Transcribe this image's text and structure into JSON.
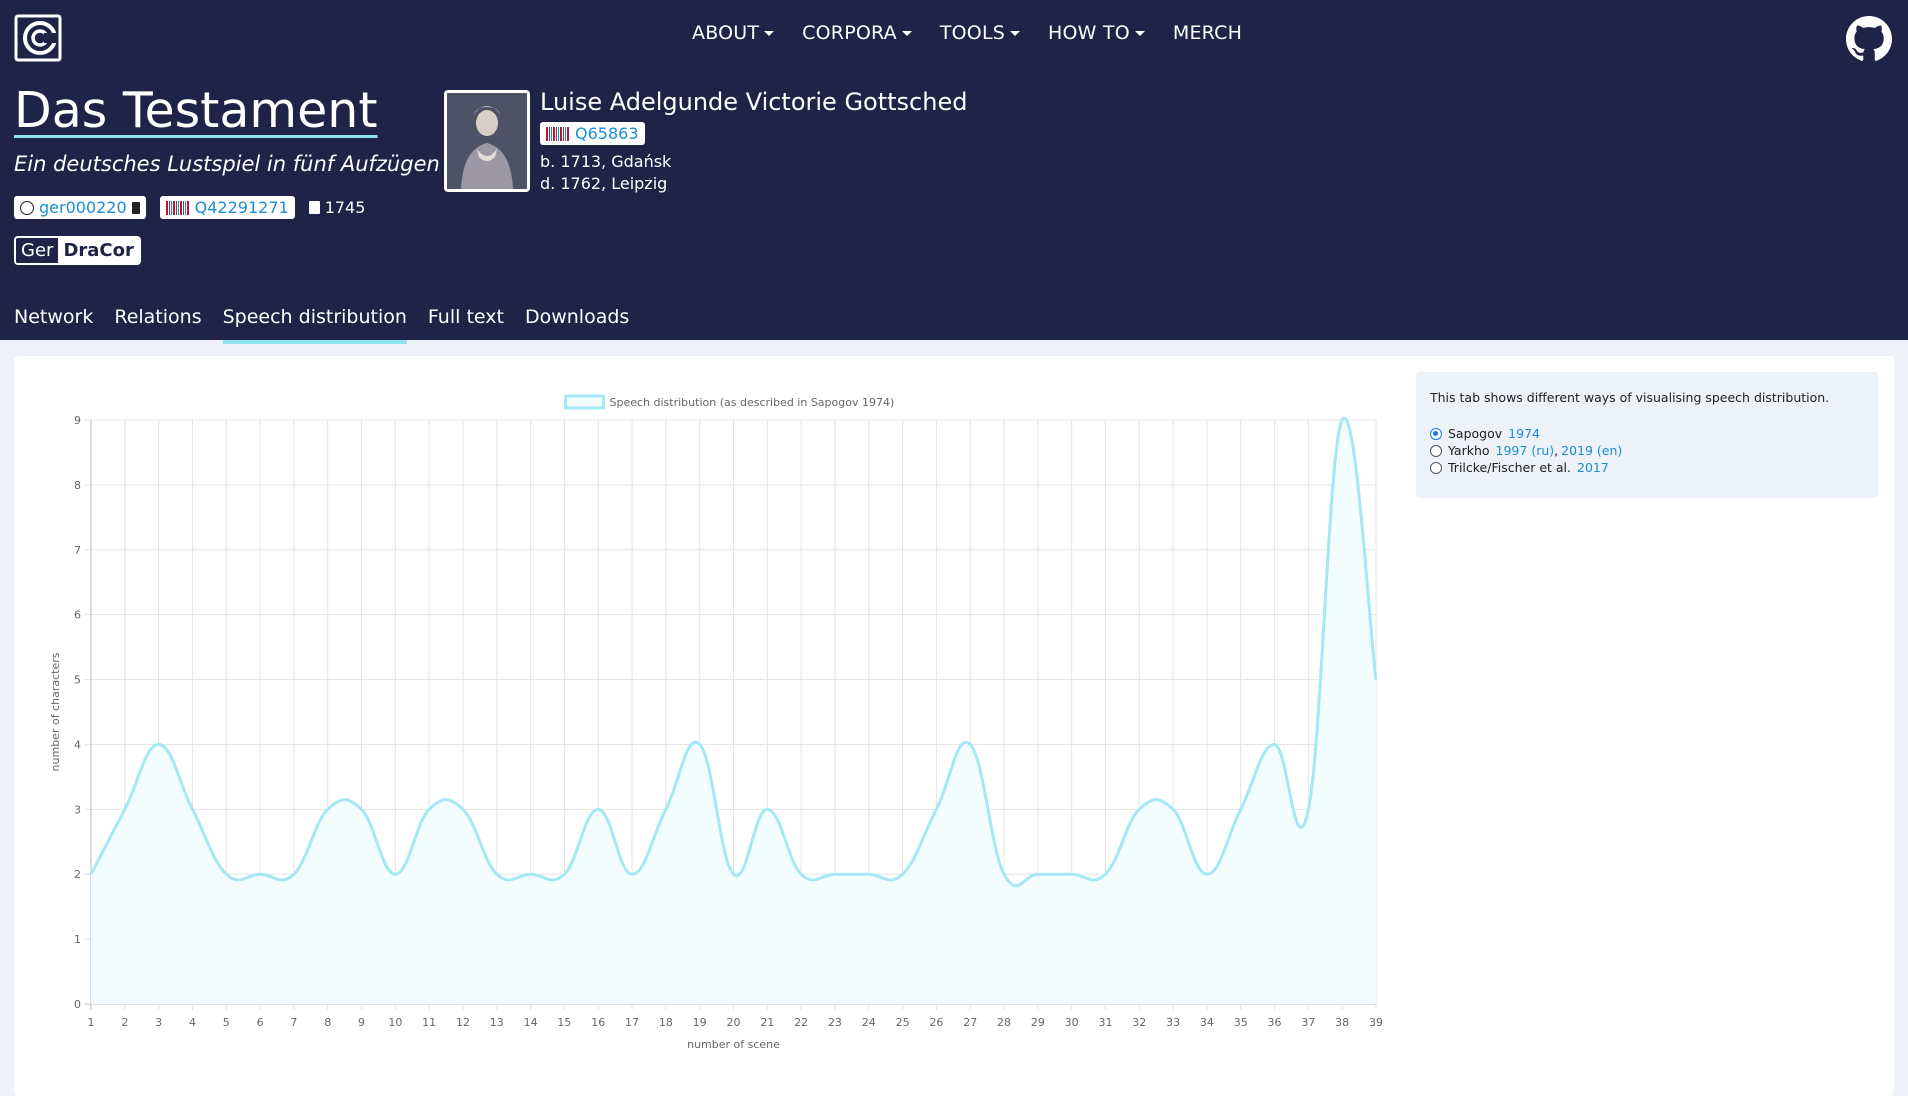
{
  "nav": {
    "items": [
      {
        "label": "ABOUT",
        "dropdown": true
      },
      {
        "label": "CORPORA",
        "dropdown": true
      },
      {
        "label": "TOOLS",
        "dropdown": true
      },
      {
        "label": "HOW TO",
        "dropdown": true
      },
      {
        "label": "MERCH",
        "dropdown": false
      }
    ]
  },
  "play": {
    "title": "Das Testament",
    "subtitle": "Ein deutsches Lustspiel in fünf Aufzügen",
    "dracor_id": "ger000220",
    "wikidata_id": "Q42291271",
    "year": "1745",
    "corpus_prefix": "Ger",
    "corpus_name": "DraCor"
  },
  "author": {
    "name": "Luise Adelgunde Victorie Gottsched",
    "wikidata_id": "Q65863",
    "born": "b. 1713, Gdańsk",
    "died": "d. 1762, Leipzig"
  },
  "tabs": [
    {
      "label": "Network",
      "active": false
    },
    {
      "label": "Relations",
      "active": false
    },
    {
      "label": "Speech distribution",
      "active": true
    },
    {
      "label": "Full text",
      "active": false
    },
    {
      "label": "Downloads",
      "active": false
    }
  ],
  "sidebar": {
    "description": "This tab shows different ways of visualising speech distribution.",
    "options": [
      {
        "name": "Sapogov",
        "links": [
          "1974"
        ],
        "selected": true
      },
      {
        "name": "Yarkho",
        "links": [
          "1997 (ru)",
          "2019 (en)"
        ],
        "selected": false
      },
      {
        "name": "Trilcke/Fischer et al.",
        "links": [
          "2017"
        ],
        "selected": false
      }
    ]
  },
  "colors": {
    "header_bg": "#1f2348",
    "accent": "#8ee3ee",
    "link": "#1a8fd4",
    "series_line": "#a5e8f5",
    "series_fill": "#f3fcfe"
  },
  "chart_data": {
    "type": "line",
    "legend": "Speech distribution (as described in Sapogov 1974)",
    "legend_position": "top",
    "xlabel": "number of scene",
    "ylabel": "number of characters",
    "x": [
      1,
      2,
      3,
      4,
      5,
      6,
      7,
      8,
      9,
      10,
      11,
      12,
      13,
      14,
      15,
      16,
      17,
      18,
      19,
      20,
      21,
      22,
      23,
      24,
      25,
      26,
      27,
      28,
      29,
      30,
      31,
      32,
      33,
      34,
      35,
      36,
      37,
      38,
      39
    ],
    "series": [
      {
        "name": "Speech distribution (as described in Sapogov 1974)",
        "values": [
          2,
          3,
          4,
          3,
          2,
          2,
          2,
          3,
          3,
          2,
          3,
          3,
          2,
          2,
          2,
          3,
          2,
          3,
          4,
          2,
          3,
          2,
          2,
          2,
          2,
          3,
          4,
          2,
          2,
          2,
          2,
          3,
          3,
          2,
          3,
          4,
          3,
          9,
          5
        ]
      }
    ],
    "ylim": [
      0,
      9
    ],
    "yticks": [
      0,
      1,
      2,
      3,
      4,
      5,
      6,
      7,
      8,
      9
    ],
    "grid": true,
    "filled": true
  }
}
